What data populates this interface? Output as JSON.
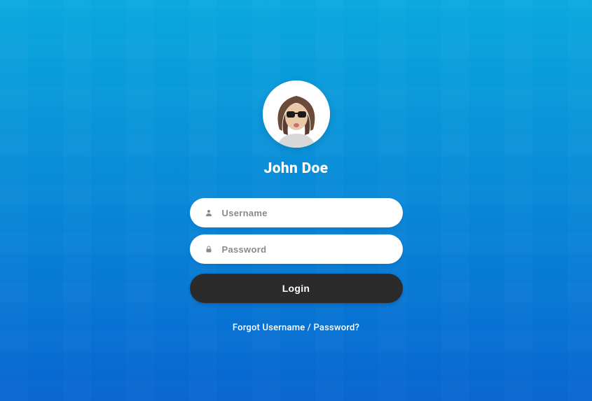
{
  "user": {
    "display_name": "John Doe"
  },
  "form": {
    "username": {
      "placeholder": "Username",
      "value": "",
      "icon": "user-icon"
    },
    "password": {
      "placeholder": "Password",
      "value": "",
      "icon": "lock-icon"
    },
    "login_button_label": "Login",
    "forgot_link_label": "Forgot Username / Password?"
  },
  "colors": {
    "background_top": "#0aa8de",
    "background_bottom": "#0765d0",
    "button_bg": "#2b2b2b",
    "input_bg": "#ffffff",
    "text_light": "#ffffff",
    "placeholder": "#8a8a8a"
  }
}
